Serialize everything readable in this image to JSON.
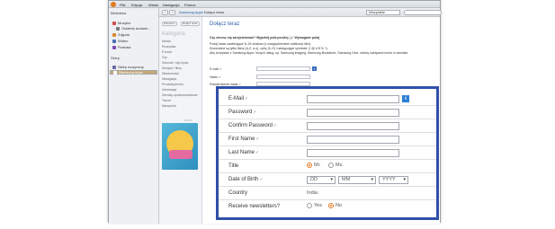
{
  "window": {
    "menu": [
      "Plik",
      "Edycja",
      "Widok",
      "Nawigacja",
      "Pomoc"
    ]
  },
  "sidebar": {
    "header1": "Biblioteka",
    "items": [
      {
        "label": "Muzyka",
        "color": "#d14b4b"
      },
      {
        "label": "Ostatnio dodane...",
        "color": "#7a7a7a"
      },
      {
        "label": "Zdjęcia",
        "color": "#d9892a"
      },
      {
        "label": "Wideo",
        "color": "#4a6fb5"
      },
      {
        "label": "Podcast",
        "color": "#7a4ab5"
      }
    ],
    "header2": "Sklep",
    "store_items": [
      {
        "label": "Sklep muzyczny",
        "color": "#6a6aa8"
      },
      {
        "label": "Samsung Apps",
        "color": "#c0a060",
        "selected": true
      }
    ]
  },
  "toolbar": {
    "back": "‹",
    "forward": "›",
    "logo_text": "Samsung Apps",
    "breadcrumb": "Dołącz teraz",
    "filter_value": "Wszystkie"
  },
  "store_left": {
    "pill1": "Polecane",
    "pill2": "Dołącz teraz",
    "category_title": "Kategoria",
    "categories": [
      "Media",
      "Rozrywka",
      "E-book",
      "Gry",
      "Zdrowie i styl życia",
      "Muzyka i filmy",
      "Wiadomości",
      "Nawigacja",
      "Produktywność",
      "Informacje",
      "Serwisy społecznościowe",
      "Travel",
      "Narzędzia"
    ]
  },
  "store_main": {
    "title": "Dołącz teraz",
    "question": "Czy chcesz się zarejestrować? Wypełnij pola poniżej. (✓ Wymagane pola)",
    "note1": "Podaj hasło zawierające 8–15 znaków (z uwzględnieniem wielkości liter).",
    "note2": "Dozwolone są tylko litery (A-Z, a-z), cyfry (0–9) i następujące symbole: (! @ # $ % ^).",
    "note3": "Aby korzystać z Samsung Apps i innych usług, np. Samsung imaging, Samsung Bookstore, Samsung Dive, należy uaktywnić konto w serwisie.",
    "email_label": "E-mail ✓",
    "pwd_label": "Hasło ✓",
    "confirm_label": "Potwierdzenie hasła ✓",
    "info": "i"
  },
  "form": {
    "email_label": "E-Mail",
    "password_label": "Password",
    "confirm_label": "Confirm Password",
    "first_name_label": "First Name",
    "last_name_label": "Last Name",
    "title_label": "Title",
    "title_options": [
      {
        "label": "Mr.",
        "checked": true
      },
      {
        "label": "Ms.",
        "checked": false
      }
    ],
    "dob_label": "Date of Birth",
    "dob_day": "DD",
    "dob_month": "MM",
    "dob_year": "YYYY",
    "country_label": "Country",
    "country_value": "India",
    "newsletter_label": "Receive newsletters?",
    "newsletter_options": [
      {
        "label": "Yes",
        "checked": false
      },
      {
        "label": "No",
        "checked": true
      }
    ],
    "required_mark": "✓",
    "info_icon": "i",
    "accent_color": "#2f4fa8"
  }
}
